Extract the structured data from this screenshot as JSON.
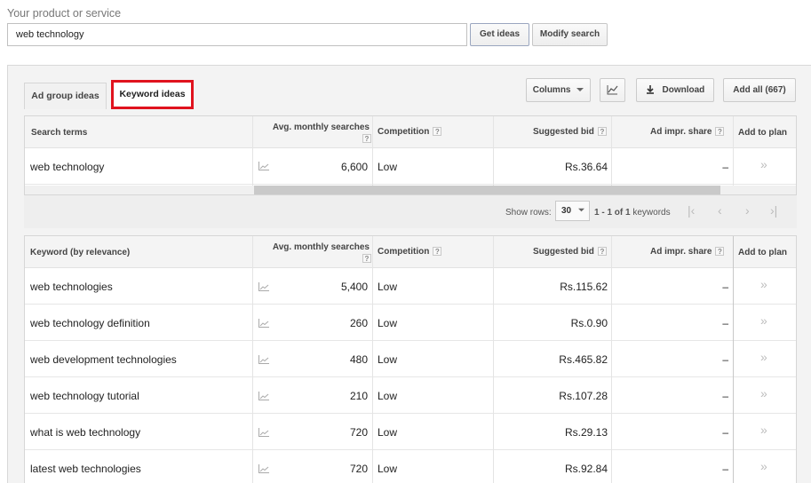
{
  "header": {
    "product_label": "Your product or service",
    "search_value": "web technology",
    "get_ideas": "Get ideas",
    "modify_search": "Modify search"
  },
  "tabs": [
    {
      "label": "Ad group ideas"
    },
    {
      "label": "Keyword ideas"
    }
  ],
  "toolbar": {
    "columns": "Columns",
    "download": "Download",
    "add_all": "Add all (667)"
  },
  "search_table": {
    "headers": {
      "term": "Search terms",
      "avg": "Avg. monthly searches",
      "competition": "Competition",
      "bid": "Suggested bid",
      "share": "Ad impr. share",
      "add": "Add to plan"
    },
    "rows": [
      {
        "term": "web technology",
        "avg": "6,600",
        "competition": "Low",
        "bid": "Rs.36.64",
        "share": "–"
      }
    ]
  },
  "pager": {
    "show_rows": "Show rows:",
    "rows_value": "30",
    "range_prefix": "1 - 1 of ",
    "range_total": "1",
    "range_suffix": " keywords"
  },
  "keyword_table": {
    "headers": {
      "term": "Keyword (by relevance)",
      "avg": "Avg. monthly searches",
      "competition": "Competition",
      "bid": "Suggested bid",
      "share": "Ad impr. share",
      "add": "Add to plan"
    },
    "rows": [
      {
        "term": "web technologies",
        "avg": "5,400",
        "competition": "Low",
        "bid": "Rs.115.62",
        "share": "–"
      },
      {
        "term": "web technology definition",
        "avg": "260",
        "competition": "Low",
        "bid": "Rs.0.90",
        "share": "–"
      },
      {
        "term": "web development technologies",
        "avg": "480",
        "competition": "Low",
        "bid": "Rs.465.82",
        "share": "–"
      },
      {
        "term": "web technology tutorial",
        "avg": "210",
        "competition": "Low",
        "bid": "Rs.107.28",
        "share": "–"
      },
      {
        "term": "what is web technology",
        "avg": "720",
        "competition": "Low",
        "bid": "Rs.29.13",
        "share": "–"
      },
      {
        "term": "latest web technologies",
        "avg": "720",
        "competition": "Low",
        "bid": "Rs.92.84",
        "share": "–"
      }
    ]
  },
  "icons": {
    "help": "help-icon",
    "trend": "trend-chart-icon",
    "add": "double-chevron-right-icon",
    "download": "download-icon",
    "dropdown": "caret-down-icon"
  },
  "colors": {
    "highlight": "#e0131e"
  }
}
